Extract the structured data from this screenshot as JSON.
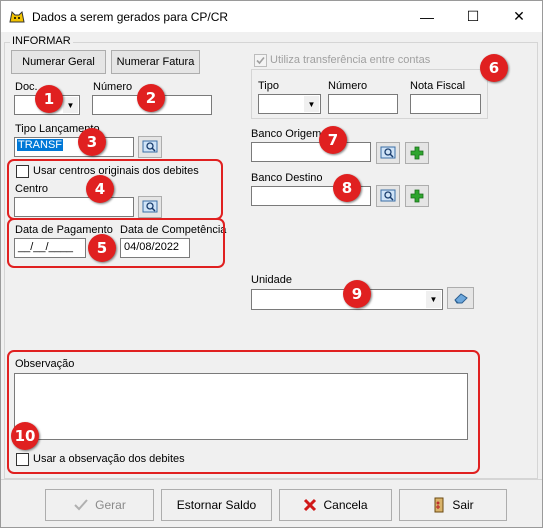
{
  "window": {
    "title": "Dados a serem gerados para CP/CR",
    "minimize": "—",
    "maximize": "☐",
    "close": "✕"
  },
  "form": {
    "group_title": "INFORMAR",
    "numerar_geral": "Numerar Geral",
    "numerar_fatura": "Numerar Fatura",
    "doc_label": "Doc.",
    "doc_value": "",
    "numero_label": "Número",
    "numero_value": "",
    "tipo_lancamento_label": "Tipo Lançamento",
    "tipo_lancamento_value": "TRANSF",
    "usar_centros_label": "Usar centros originais dos debites",
    "centro_label": "Centro",
    "centro_value": "",
    "data_pagamento_label": "Data de Pagamento",
    "data_pagamento_value": "__/__/____",
    "data_competencia_label": "Data de Competência",
    "data_competencia_value": "04/08/2022",
    "utiliza_transferencia_label": "Utiliza transferência entre contas",
    "transf_tipo_label": "Tipo",
    "transf_numero_label": "Número",
    "transf_nota_label": "Nota Fiscal",
    "banco_origem_label": "Banco Origem",
    "banco_destino_label": "Banco Destino",
    "unidade_label": "Unidade",
    "observacao_label": "Observação",
    "observacao_value": "",
    "usar_observacao_label": "Usar a observação dos debites"
  },
  "callouts": [
    "1",
    "2",
    "3",
    "4",
    "5",
    "6",
    "7",
    "8",
    "9",
    "10"
  ],
  "buttons": {
    "gerar": "Gerar",
    "estornar": "Estornar Saldo",
    "cancela": "Cancela",
    "sair": "Sair"
  },
  "colors": {
    "callout_red": "#e02020",
    "selection_blue": "#0078d7",
    "add_green": "#2fa52f"
  }
}
